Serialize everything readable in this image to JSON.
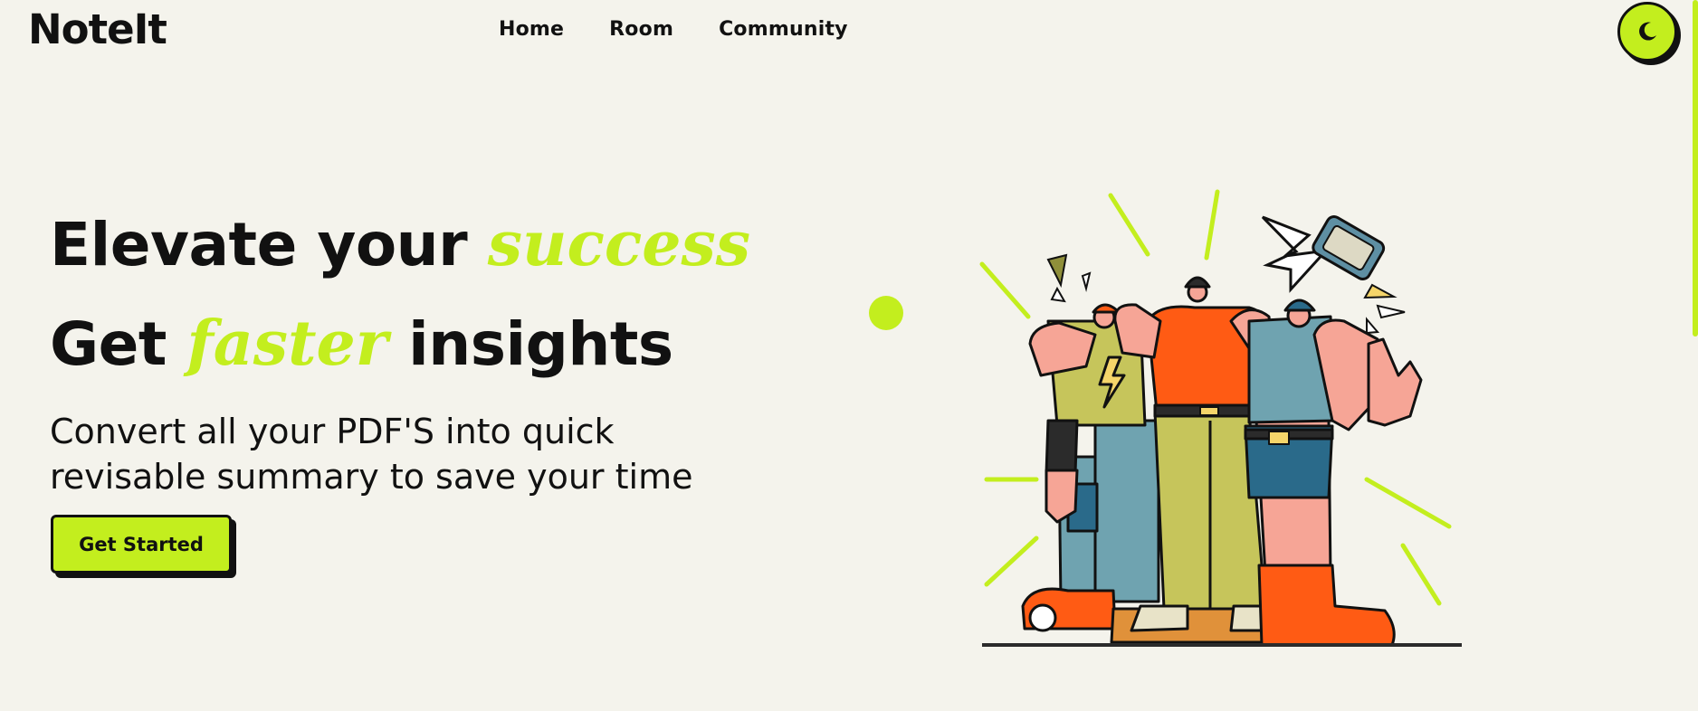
{
  "brand": {
    "logo": "NoteIt"
  },
  "nav": {
    "items": [
      "Home",
      "Room",
      "Community"
    ]
  },
  "theme_toggle": {
    "icon": "moon-icon"
  },
  "hero": {
    "line1_prefix": "Elevate your",
    "line1_accent": "success",
    "line2_prefix": "Get",
    "line2_accent": "faster",
    "line2_suffix": "insights",
    "subtitle": "Convert all your PDF'S into quick revisable summary to save your time",
    "cta_label": "Get Started"
  },
  "colors": {
    "accent": "#c3ee1e",
    "background": "#f4f3ec",
    "text": "#111111"
  }
}
